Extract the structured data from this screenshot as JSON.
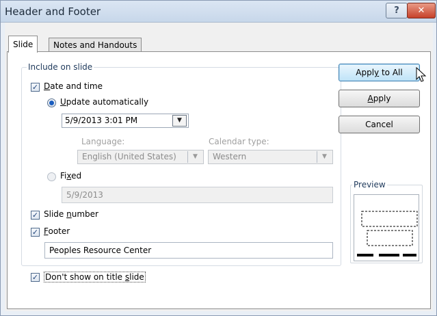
{
  "window": {
    "title": "Header and Footer",
    "help_glyph": "?",
    "close_glyph": "✕"
  },
  "tabs": [
    {
      "label": "Slide",
      "active": true
    },
    {
      "label": "Notes and Handouts",
      "active": false
    }
  ],
  "include_group": {
    "label": "Include on slide",
    "date_time": {
      "checked": true,
      "label_pre": "",
      "label_key": "D",
      "label_post": "ate and time",
      "update_auto": {
        "selected": true,
        "key": "U",
        "post": "pdate automatically"
      },
      "date_value": "5/9/2013 3:01 PM",
      "language_label": "Language:",
      "language_value": "English (United States)",
      "calendar_label": "Calendar type:",
      "calendar_value": "Western",
      "fixed": {
        "selected": false,
        "pre": "Fi",
        "key": "x",
        "post": "ed"
      },
      "fixed_value": "5/9/2013"
    },
    "slide_number": {
      "checked": true,
      "pre": "Slide ",
      "key": "n",
      "post": "umber"
    },
    "footer": {
      "checked": true,
      "key": "F",
      "post": "ooter",
      "value": "Peoples Resource Center"
    }
  },
  "dont_show_title": {
    "checked": true,
    "pre": "Don't show on title ",
    "key": "s",
    "post": "lide"
  },
  "buttons": {
    "apply_all": {
      "pre": "Appl",
      "key": "y",
      "post": " to All"
    },
    "apply": {
      "pre": "",
      "key": "A",
      "post": "pply"
    },
    "cancel": "Cancel"
  },
  "preview": {
    "label": "Preview"
  },
  "colors": {
    "accent": "#1a5dbf",
    "close": "#c6412a"
  }
}
